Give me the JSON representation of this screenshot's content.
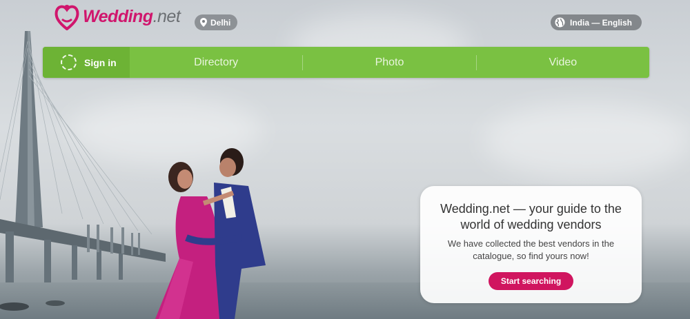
{
  "brand": {
    "name": "Wedding",
    "suffix": ".net",
    "color": "#d0166d"
  },
  "location": {
    "city": "Delhi",
    "icon": "map-pin-icon"
  },
  "language": {
    "label": "India — English",
    "icon": "globe-icon"
  },
  "nav": {
    "signin_label": "Sign in",
    "items": [
      {
        "label": "Directory"
      },
      {
        "label": "Photo"
      },
      {
        "label": "Video"
      }
    ],
    "color": "#7ac142"
  },
  "hero": {
    "title": "Wedding.net — your guide to the world of wedding vendors",
    "subtitle": "We have collected the best vendors in the catalogue, so find yours now!",
    "cta_label": "Start searching",
    "cta_color": "#d0155f"
  }
}
